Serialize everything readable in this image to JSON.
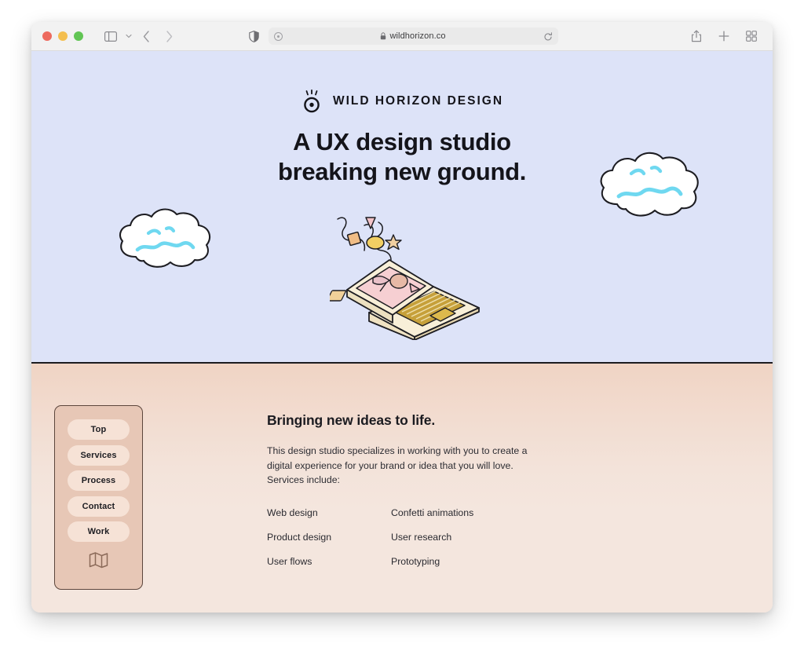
{
  "browser": {
    "traffic_lights": [
      "close",
      "minimize",
      "maximize"
    ],
    "sidebar_toggle_label": "Show sidebar",
    "tab_group_chevron_label": "Tab group options",
    "back_label": "Back",
    "forward_label": "Forward",
    "shield_label": "Privacy report",
    "zoom_label": "Page zoom",
    "url": "wildhorizon.co",
    "reload_label": "Reload",
    "share_label": "Share",
    "new_tab_label": "New tab",
    "tab_overview_label": "Tab overview"
  },
  "hero": {
    "brand_name": "WILD HORIZON DESIGN",
    "brand_mark_icon": "eye-circle-icon",
    "headline_line1": "A UX design studio",
    "headline_line2": "breaking new ground.",
    "background_color": "#dde3f8",
    "illustration_icon": "laptop-confetti-illustration",
    "cloud_left_icon": "cloud-icon",
    "cloud_right_icon": "cloud-icon"
  },
  "content": {
    "background_color": "#f4e6de",
    "nav": {
      "items": [
        {
          "label": "Top"
        },
        {
          "label": "Services"
        },
        {
          "label": "Process"
        },
        {
          "label": "Contact"
        },
        {
          "label": "Work"
        }
      ],
      "map_icon": "map-icon",
      "panel_color": "#e7c7b6",
      "pill_color": "#f6e2d6"
    },
    "title": "Bringing new ideas to life.",
    "paragraph": "This design studio specializes in working with you to create a digital experience for your brand or idea that you will love. Services include:",
    "services": [
      "Web design",
      "Confetti animations",
      "Product design",
      "User research",
      "User flows",
      "Prototyping"
    ]
  }
}
